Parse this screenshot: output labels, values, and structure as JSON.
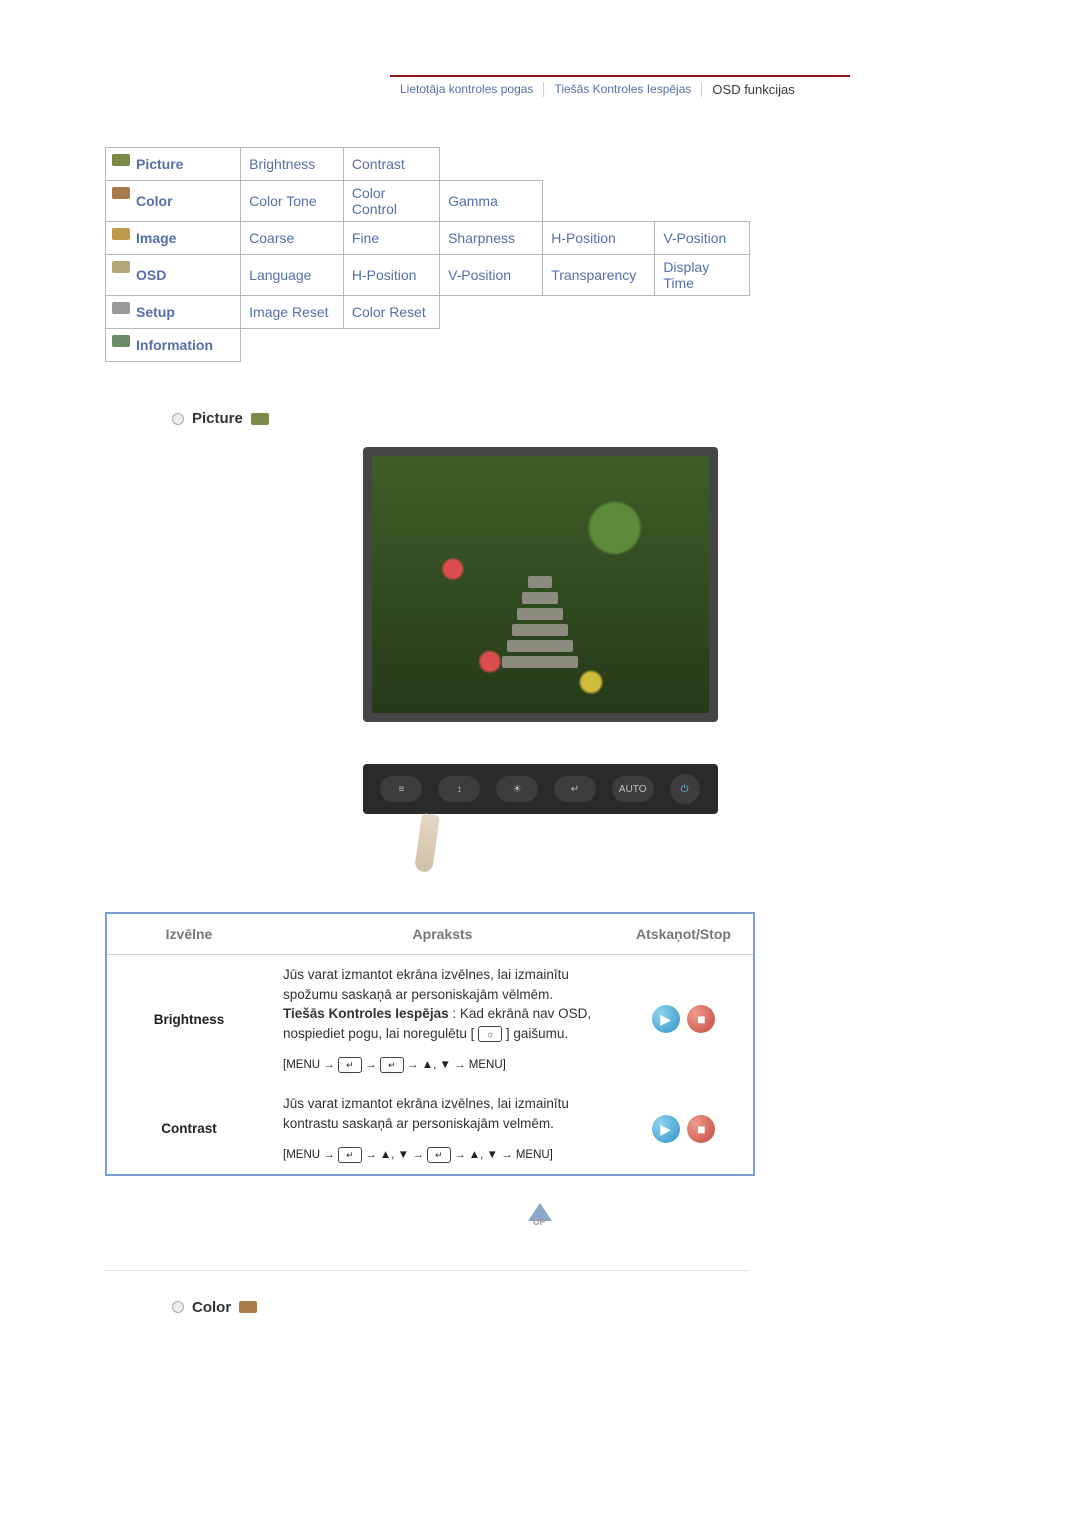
{
  "tabs": {
    "t1": "Lietotāja kontroles pogas",
    "t2": "Tiešās Kontroles Iespējas",
    "t3": "OSD funkcijas"
  },
  "nav": {
    "picture": {
      "label": "Picture",
      "s1": "Brightness",
      "s2": "Contrast"
    },
    "color": {
      "label": "Color",
      "s1": "Color Tone",
      "s2": "Color Control",
      "s3": "Gamma"
    },
    "image": {
      "label": "Image",
      "s1": "Coarse",
      "s2": "Fine",
      "s3": "Sharpness",
      "s4": "H-Position",
      "s5": "V-Position"
    },
    "osd": {
      "label": "OSD",
      "s1": "Language",
      "s2": "H-Position",
      "s3": "V-Position",
      "s4": "Transparency",
      "s5": "Display Time"
    },
    "setup": {
      "label": "Setup",
      "s1": "Image Reset",
      "s2": "Color Reset"
    },
    "info": {
      "label": "Information"
    }
  },
  "sections": {
    "picture_title": "Picture",
    "color_title": "Color"
  },
  "buttons": {
    "menu": "≡",
    "adj": "↕",
    "bri": "☀",
    "enter": "↵",
    "auto": "AUTO",
    "power": "⏻"
  },
  "desc_headers": {
    "menu": "Izvēlne",
    "desc": "Apraksts",
    "play": "Atskaņot/Stop"
  },
  "brightness": {
    "name": "Brightness",
    "p1": "Jūs varat izmantot ekrāna izvēlnes, lai izmainītu spožumu saskaņā ar personiskajām vēlmēm.",
    "p2a": "Tiešās Kontroles Iespējas",
    "p2b": " : Kad ekrānā nav OSD, nospiediet pogu, lai noregulētu [ ",
    "p2c": " ] gaišumu.",
    "seq_a": "[MENU → ",
    "seq_b": " → ",
    "seq_c": " → ▲, ▼ → MENU]"
  },
  "contrast": {
    "name": "Contrast",
    "p1": "Jūs varat izmantot ekrāna izvēlnes, lai izmainītu kontrastu saskaņā ar personiskajām velmēm.",
    "seq_a": "[MENU → ",
    "seq_b": " → ▲, ▼ → ",
    "seq_c": " → ▲, ▼ → MENU]"
  },
  "up_label": "UP"
}
